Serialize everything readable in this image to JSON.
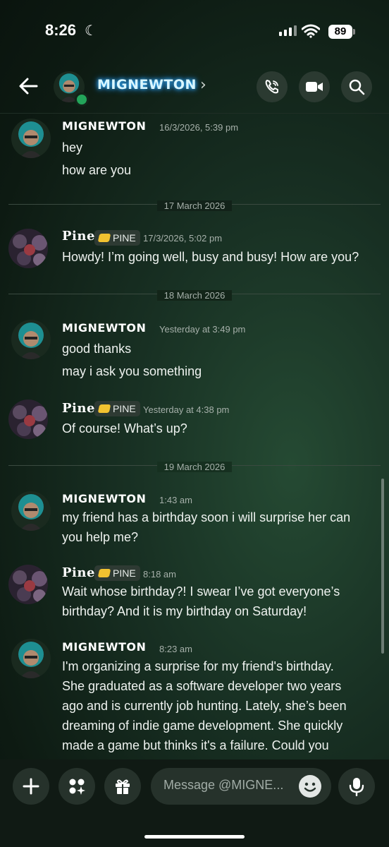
{
  "status_bar": {
    "time": "8:26",
    "battery": "89"
  },
  "header": {
    "name": "MIGNEWTON"
  },
  "dates": [
    "17 March 2026",
    "18 March 2026",
    "19 March 2026"
  ],
  "messages": [
    {
      "author": "MIGNEWTON",
      "timestamp": "16/3/2026, 5:39 pm",
      "lines": [
        "hey",
        "how are you"
      ]
    },
    {
      "author": "Pine",
      "tag": "PINE",
      "timestamp": "17/3/2026, 5:02 pm",
      "lines": [
        "Howdy! I’m going well, busy and busy! How are you?"
      ]
    },
    {
      "author": "MIGNEWTON",
      "timestamp": "Yesterday at 3:49 pm",
      "lines": [
        "good thanks",
        "may i ask you something"
      ]
    },
    {
      "author": "Pine",
      "tag": "PINE",
      "timestamp": "Yesterday at 4:38 pm",
      "lines": [
        "Of course! What’s up?"
      ]
    },
    {
      "author": "MIGNEWTON",
      "timestamp": "1:43 am",
      "lines": [
        "my friend has a birthday soon i will surprise her can",
        "you help me?"
      ]
    },
    {
      "author": "Pine",
      "tag": "PINE",
      "timestamp": "8:18 am",
      "lines": [
        "Wait whose birthday?! I swear I’ve got everyone’s",
        "birthday? And it is my birthday on Saturday!"
      ]
    },
    {
      "author": "MIGNEWTON",
      "timestamp": "8:23 am",
      "lines": [
        "I'm organizing a surprise for my friend's birthday.",
        "She graduated as a software developer two years",
        "ago and is currently job hunting. Lately, she’s been",
        "dreaming of indie game development. She quickly",
        "made a game but thinks it's a failure. Could you"
      ]
    }
  ],
  "composer": {
    "placeholder": "Message @MIGNE..."
  },
  "icons": {
    "back": "arrow-left-icon",
    "call": "phone-icon",
    "video": "video-camera-icon",
    "search": "search-icon",
    "plus": "plus-icon",
    "apps": "apps-icon",
    "gift": "gift-icon",
    "emoji": "emoji-icon",
    "mic": "microphone-icon"
  },
  "colors": {
    "online": "#23a55a",
    "name_glow": "#35b6ff",
    "tag_icon": "#f2c230"
  }
}
